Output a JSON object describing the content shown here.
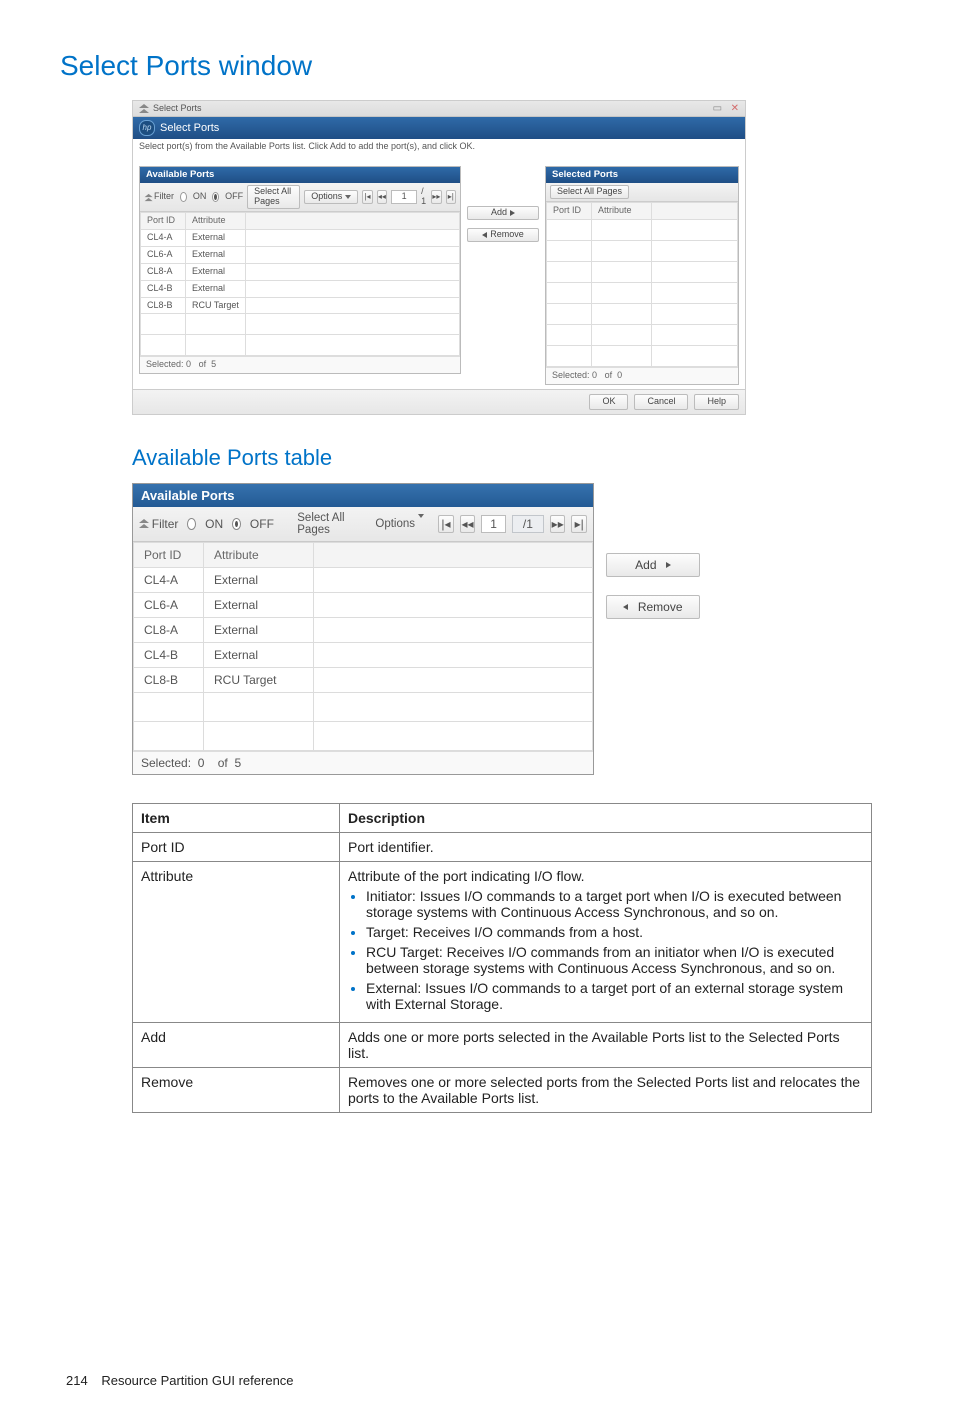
{
  "page": {
    "title": "Select Ports window",
    "subtitle": "Available Ports table",
    "footer_page": "214",
    "footer_text": "Resource Partition GUI reference"
  },
  "window": {
    "titlebar": "Select Ports",
    "header": "Select Ports",
    "instruction": "Select port(s) from the Available Ports list. Click Add to add the port(s), and click OK.",
    "buttons": {
      "ok": "OK",
      "cancel": "Cancel",
      "help": "Help",
      "add": "Add",
      "remove": "Remove",
      "select_all": "Select All Pages",
      "options": "Options"
    },
    "filter": {
      "label": "Filter",
      "on": "ON",
      "off": "OFF"
    },
    "pager": {
      "current": "1",
      "total": "1"
    }
  },
  "available": {
    "title": "Available Ports",
    "cols": {
      "port": "Port ID",
      "attr": "Attribute"
    },
    "rows": [
      {
        "port": "CL4-A",
        "attr": "External"
      },
      {
        "port": "CL6-A",
        "attr": "External"
      },
      {
        "port": "CL8-A",
        "attr": "External"
      },
      {
        "port": "CL4-B",
        "attr": "External"
      },
      {
        "port": "CL8-B",
        "attr": "RCU Target"
      }
    ],
    "selected_label": "Selected:",
    "selected_n": "0",
    "of": "of",
    "total": "5"
  },
  "selected": {
    "title": "Selected Ports",
    "selected_label": "Selected:",
    "selected_n": "0",
    "of": "of",
    "total": "0"
  },
  "desc": {
    "head_item": "Item",
    "head_desc": "Description",
    "rows": {
      "portid": {
        "item": "Port ID",
        "desc": "Port identifier."
      },
      "attribute": {
        "item": "Attribute",
        "lead": "Attribute of the port indicating I/O flow.",
        "bullets": [
          "Initiator: Issues I/O commands to a target port when I/O is executed between storage systems with Continuous Access Synchronous, and so on.",
          "Target: Receives I/O commands from a host.",
          "RCU Target: Receives I/O commands from an initiator when I/O is executed between storage systems with Continuous Access Synchronous, and so on.",
          "External: Issues I/O commands to a target port of an external storage system with External Storage."
        ]
      },
      "add": {
        "item": "Add",
        "desc": "Adds one or more ports selected in the Available Ports list to the Selected Ports list."
      },
      "remove": {
        "item": "Remove",
        "desc": "Removes one or more selected ports from the Selected Ports list and relocates the ports to the Available Ports list."
      }
    }
  }
}
